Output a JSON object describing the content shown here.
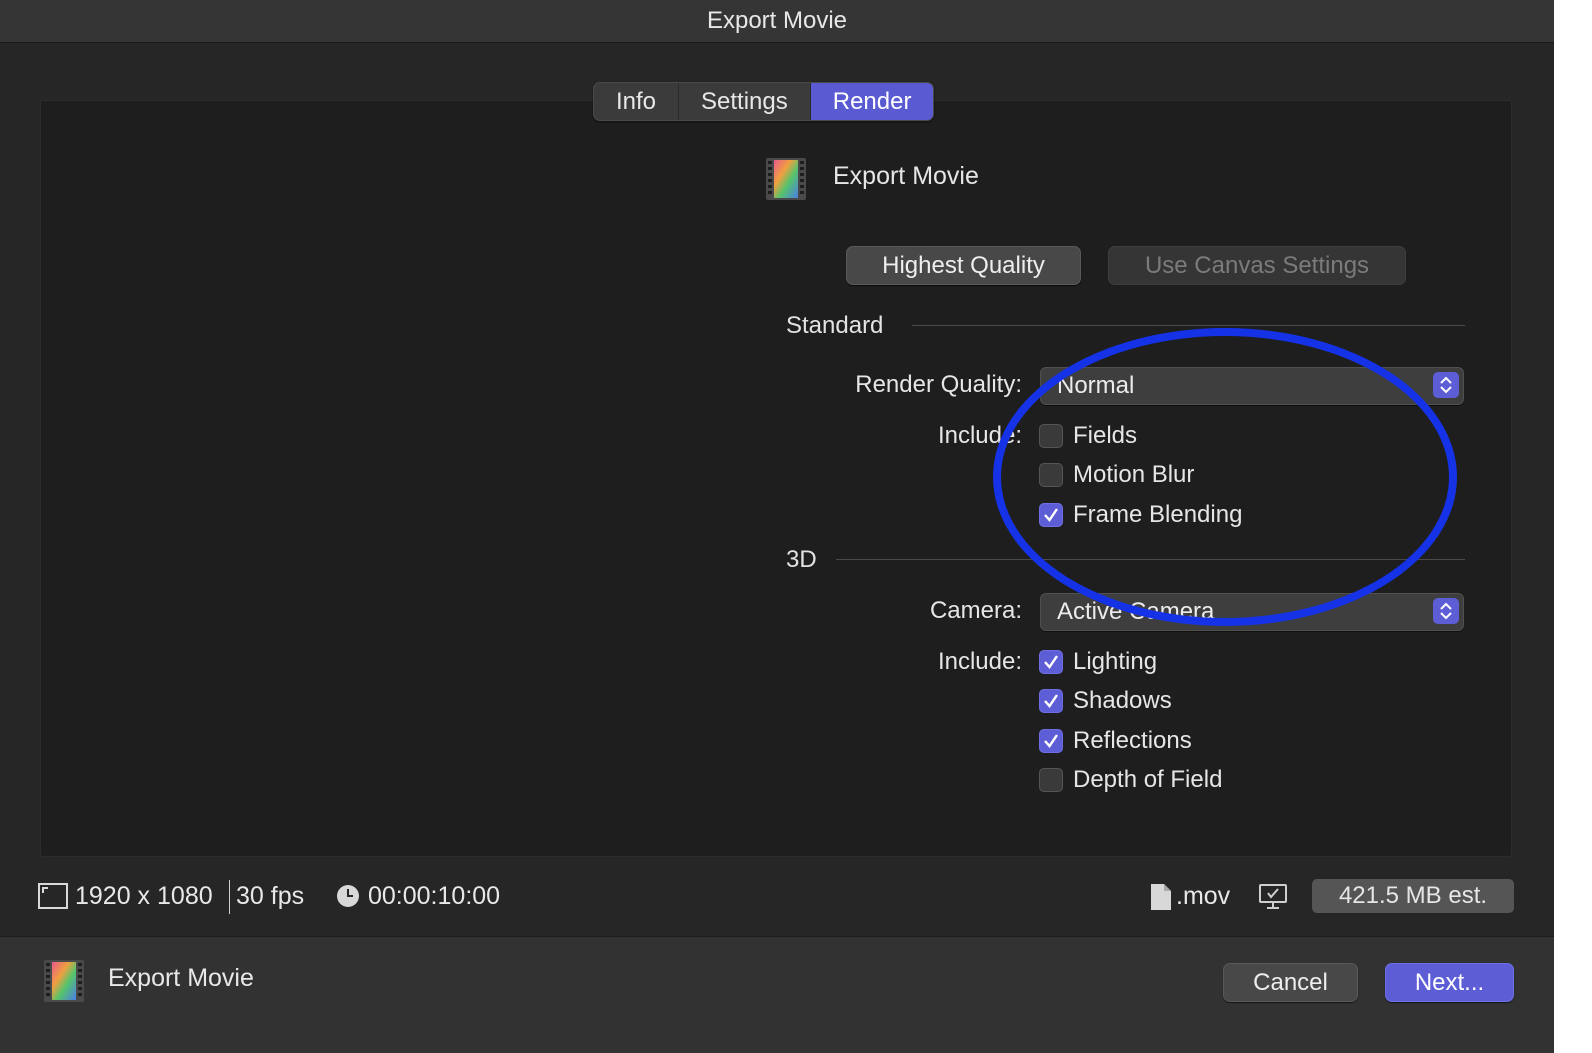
{
  "window": {
    "title": "Export Movie"
  },
  "tabs": [
    {
      "label": "Info",
      "active": false
    },
    {
      "label": "Settings",
      "active": false
    },
    {
      "label": "Render",
      "active": true
    }
  ],
  "header": {
    "preset_name": "Export Movie",
    "icon": "film-strip-icon"
  },
  "presets": {
    "highest_quality": "Highest Quality",
    "use_canvas": "Use Canvas Settings"
  },
  "standard": {
    "section_title": "Standard",
    "render_quality_label": "Render Quality:",
    "render_quality_value": "Normal",
    "include_label": "Include:",
    "options": [
      {
        "label": "Fields",
        "checked": false
      },
      {
        "label": "Motion Blur",
        "checked": false
      },
      {
        "label": "Frame Blending",
        "checked": true
      }
    ]
  },
  "three_d": {
    "section_title": "3D",
    "camera_label": "Camera:",
    "camera_value": "Active Camera",
    "include_label": "Include:",
    "options": [
      {
        "label": "Lighting",
        "checked": true
      },
      {
        "label": "Shadows",
        "checked": true
      },
      {
        "label": "Reflections",
        "checked": true
      },
      {
        "label": "Depth of Field",
        "checked": false
      }
    ]
  },
  "footer": {
    "resolution": "1920 x 1080",
    "fps": "30 fps",
    "duration": "00:00:10:00",
    "format": ".mov",
    "size_estimate": "421.5 MB est."
  },
  "bottom": {
    "title": "Export Movie",
    "cancel": "Cancel",
    "next": "Next..."
  },
  "colors": {
    "accent": "#5d5ed6",
    "annotation": "#1532e6",
    "background": "#262626"
  }
}
